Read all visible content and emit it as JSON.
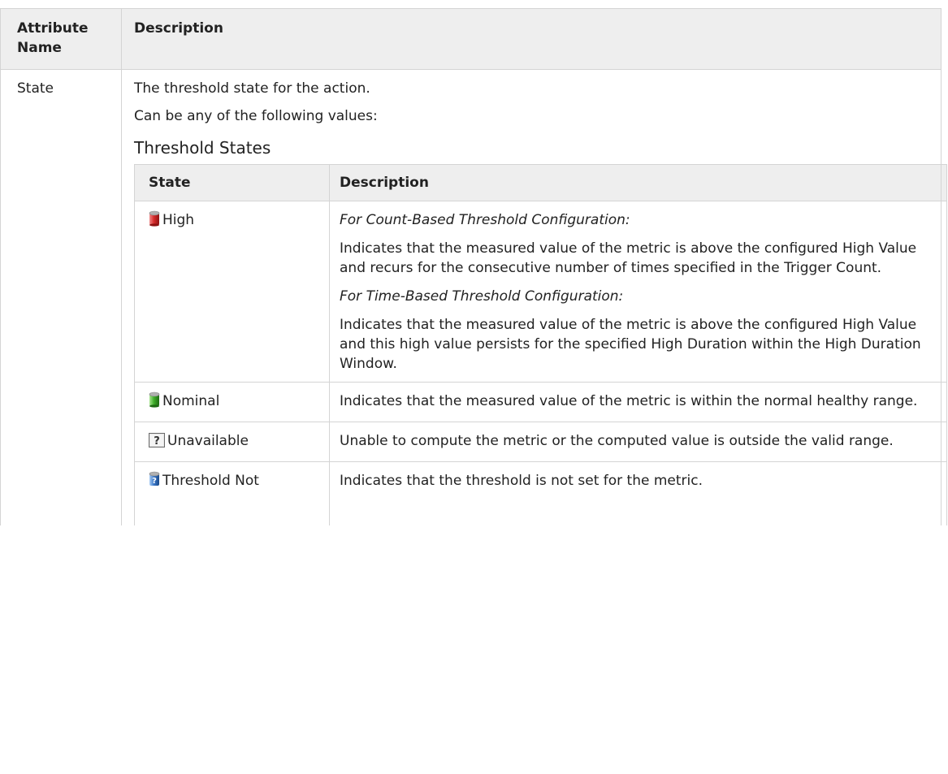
{
  "outer_table": {
    "headers": {
      "attribute_name": "Attribute Name",
      "description": "Description"
    },
    "row": {
      "attribute": "State",
      "description_line1": "The threshold state for the action.",
      "description_line2": "Can be any of the following values:"
    }
  },
  "threshold_states": {
    "caption": "Threshold States",
    "headers": {
      "state": "State",
      "description": "Description"
    },
    "rows": [
      {
        "icon": "high-state-icon",
        "icon_color": "#d62b2b",
        "state": "High",
        "paragraphs": [
          "For Count-Based Threshold Configuration:",
          "Indicates that the measured value of the metric is above the configured High Value and recurs for the consecutive number of times specified in the Trigger Count.",
          "For Time-Based Threshold Configuration:",
          "Indicates that the measured value of the metric is above the configured High Value and this high value persists for the specified High Duration within the High Duration Window."
        ]
      },
      {
        "icon": "nominal-state-icon",
        "icon_color": "#3fae2a",
        "state": "Nominal",
        "description": "Indicates that the measured value of the metric is within the normal healthy range."
      },
      {
        "icon": "unavailable-state-icon",
        "state": "Unavailable",
        "description": "Unable to compute the metric or the computed value is outside the valid range."
      },
      {
        "icon": "threshold-not-set-icon",
        "icon_color": "#3a78c9",
        "state": "Threshold Not",
        "description": "Indicates that the threshold is not set for the metric."
      }
    ]
  }
}
